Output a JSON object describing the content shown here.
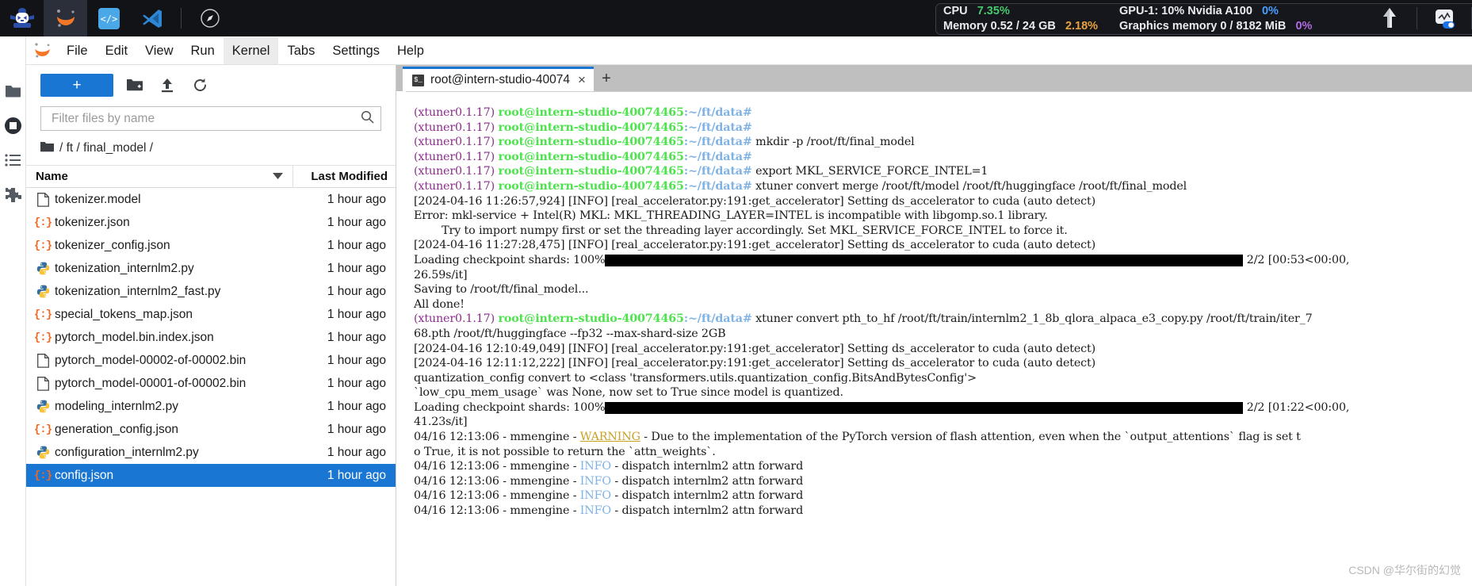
{
  "topbar": {
    "icons": [
      {
        "name": "intern-studio-logo-icon",
        "label": "InternStudio"
      },
      {
        "name": "jupyter-icon",
        "label": "Jupyter"
      },
      {
        "name": "code-server-icon",
        "label": "Code Server"
      },
      {
        "name": "vscode-icon",
        "label": "VS Code"
      },
      {
        "name": "compass-icon",
        "label": "Compass"
      }
    ],
    "stats": {
      "cpu_label": "CPU",
      "cpu_value": "7.35%",
      "memory_label": "Memory 0.52 / 24 GB",
      "memory_value": "2.18%",
      "gpu_label": "GPU-1: 10% Nvidia A100",
      "gpu_value": "0%",
      "graphics_label": "Graphics memory 0 / 8182 MiB",
      "graphics_value": "0%"
    },
    "right_icons": [
      {
        "name": "upload-arrow-icon"
      },
      {
        "name": "monitor-toggle-icon"
      }
    ]
  },
  "menubar": {
    "items": [
      {
        "label": "File",
        "name": "menu-file"
      },
      {
        "label": "Edit",
        "name": "menu-edit"
      },
      {
        "label": "View",
        "name": "menu-view"
      },
      {
        "label": "Run",
        "name": "menu-run"
      },
      {
        "label": "Kernel",
        "name": "menu-kernel",
        "active": true
      },
      {
        "label": "Tabs",
        "name": "menu-tabs"
      },
      {
        "label": "Settings",
        "name": "menu-settings"
      },
      {
        "label": "Help",
        "name": "menu-help"
      }
    ]
  },
  "rail": {
    "items": [
      {
        "name": "sidebar-file-browser-icon"
      },
      {
        "name": "sidebar-running-terminals-icon"
      },
      {
        "name": "sidebar-commands-icon"
      },
      {
        "name": "sidebar-extensions-icon"
      }
    ]
  },
  "filebrowser": {
    "new_button_label": "+",
    "toolbar_icons": [
      {
        "name": "new-folder-icon"
      },
      {
        "name": "upload-icon"
      },
      {
        "name": "refresh-icon"
      }
    ],
    "filter_placeholder": "Filter files by name",
    "filter_value": "",
    "breadcrumb": "/ ft / final_model /",
    "columns": {
      "name": "Name",
      "last_modified": "Last Modified"
    },
    "rows": [
      {
        "name": "tokenizer.model",
        "icon": "file-icon",
        "modified": "1 hour ago",
        "selected": false
      },
      {
        "name": "tokenizer.json",
        "icon": "json-icon",
        "modified": "1 hour ago",
        "selected": false
      },
      {
        "name": "tokenizer_config.json",
        "icon": "json-icon",
        "modified": "1 hour ago",
        "selected": false
      },
      {
        "name": "tokenization_internlm2.py",
        "icon": "python-icon",
        "modified": "1 hour ago",
        "selected": false
      },
      {
        "name": "tokenization_internlm2_fast.py",
        "icon": "python-icon",
        "modified": "1 hour ago",
        "selected": false
      },
      {
        "name": "special_tokens_map.json",
        "icon": "json-icon",
        "modified": "1 hour ago",
        "selected": false
      },
      {
        "name": "pytorch_model.bin.index.json",
        "icon": "json-icon",
        "modified": "1 hour ago",
        "selected": false
      },
      {
        "name": "pytorch_model-00002-of-00002.bin",
        "icon": "file-icon",
        "modified": "1 hour ago",
        "selected": false
      },
      {
        "name": "pytorch_model-00001-of-00002.bin",
        "icon": "file-icon",
        "modified": "1 hour ago",
        "selected": false
      },
      {
        "name": "modeling_internlm2.py",
        "icon": "python-icon",
        "modified": "1 hour ago",
        "selected": false
      },
      {
        "name": "generation_config.json",
        "icon": "json-icon",
        "modified": "1 hour ago",
        "selected": false
      },
      {
        "name": "configuration_internlm2.py",
        "icon": "python-icon",
        "modified": "1 hour ago",
        "selected": false
      },
      {
        "name": "config.json",
        "icon": "json-icon",
        "modified": "1 hour ago",
        "selected": true
      }
    ]
  },
  "maintab": {
    "tab_label": "root@intern-studio-40074",
    "tab_icon": "terminal-icon",
    "close_label": "×",
    "add_label": "+"
  },
  "terminal": {
    "prompt_env": "(xtuner0.1.17)",
    "prompt_user": "root@intern-studio-40074465",
    "prompt_path": ":~/ft/data#",
    "lines": [
      {
        "type": "prompt",
        "cmd": ""
      },
      {
        "type": "prompt",
        "cmd": ""
      },
      {
        "type": "prompt",
        "cmd": " mkdir -p /root/ft/final_model"
      },
      {
        "type": "prompt",
        "cmd": ""
      },
      {
        "type": "prompt",
        "cmd": " export MKL_SERVICE_FORCE_INTEL=1"
      },
      {
        "type": "prompt",
        "cmd": " xtuner convert merge /root/ft/model /root/ft/huggingface /root/ft/final_model"
      },
      {
        "type": "plain",
        "text": "[2024-04-16 11:26:57,924] [INFO] [real_accelerator.py:191:get_accelerator] Setting ds_accelerator to cuda (auto detect)"
      },
      {
        "type": "plain",
        "text": "Error: mkl-service + Intel(R) MKL: MKL_THREADING_LAYER=INTEL is incompatible with libgomp.so.1 library."
      },
      {
        "type": "plain",
        "text": "        Try to import numpy first or set the threading layer accordingly. Set MKL_SERVICE_FORCE_INTEL to force it."
      },
      {
        "type": "plain",
        "text": "[2024-04-16 11:27:28,475] [INFO] [real_accelerator.py:191:get_accelerator] Setting ds_accelerator to cuda (auto detect)"
      },
      {
        "type": "progress",
        "prefix": "Loading checkpoint shards: 100%",
        "suffix": " 2/2 [00:53<00:00,"
      },
      {
        "type": "plain",
        "text": "26.59s/it]"
      },
      {
        "type": "plain",
        "text": "Saving to /root/ft/final_model..."
      },
      {
        "type": "plain",
        "text": "All done!"
      },
      {
        "type": "prompt",
        "cmd": " xtuner convert pth_to_hf /root/ft/train/internlm2_1_8b_qlora_alpaca_e3_copy.py /root/ft/train/iter_7"
      },
      {
        "type": "plain",
        "text": "68.pth /root/ft/huggingface --fp32 --max-shard-size 2GB"
      },
      {
        "type": "plain",
        "text": "[2024-04-16 12:10:49,049] [INFO] [real_accelerator.py:191:get_accelerator] Setting ds_accelerator to cuda (auto detect)"
      },
      {
        "type": "plain",
        "text": "[2024-04-16 12:11:12,222] [INFO] [real_accelerator.py:191:get_accelerator] Setting ds_accelerator to cuda (auto detect)"
      },
      {
        "type": "plain",
        "text": "quantization_config convert to <class 'transformers.utils.quantization_config.BitsAndBytesConfig'>"
      },
      {
        "type": "plain",
        "text": "`low_cpu_mem_usage` was None, now set to True since model is quantized."
      },
      {
        "type": "progress",
        "prefix": "Loading checkpoint shards: 100%",
        "suffix": " 2/2 [01:22<00:00,"
      },
      {
        "type": "plain",
        "text": "41.23s/it]"
      },
      {
        "type": "warning",
        "pre": "04/16 12:13:06 - mmengine - ",
        "tag": "WARNING",
        "post": " - Due to the implementation of the PyTorch version of flash attention, even when the `output_attentions` flag is set t"
      },
      {
        "type": "plain",
        "text": "o True, it is not possible to return the `attn_weights`."
      },
      {
        "type": "info",
        "pre": "04/16 12:13:06 - mmengine - ",
        "tag": "INFO",
        "post": " - dispatch internlm2 attn forward"
      },
      {
        "type": "info",
        "pre": "04/16 12:13:06 - mmengine - ",
        "tag": "INFO",
        "post": " - dispatch internlm2 attn forward"
      },
      {
        "type": "info",
        "pre": "04/16 12:13:06 - mmengine - ",
        "tag": "INFO",
        "post": " - dispatch internlm2 attn forward"
      },
      {
        "type": "info",
        "pre": "04/16 12:13:06 - mmengine - ",
        "tag": "INFO",
        "post": " - dispatch internlm2 attn forward"
      }
    ]
  },
  "watermark": "CSDN @华尔街的幻觉",
  "colors": {
    "accent_blue": "#1976d2",
    "topbar_bg": "#111317",
    "prompt_green": "#4ee34e",
    "prompt_purple": "#8b2f8b",
    "prompt_path_blue": "#7fb2e5",
    "warning_yellow": "#c9a227"
  }
}
